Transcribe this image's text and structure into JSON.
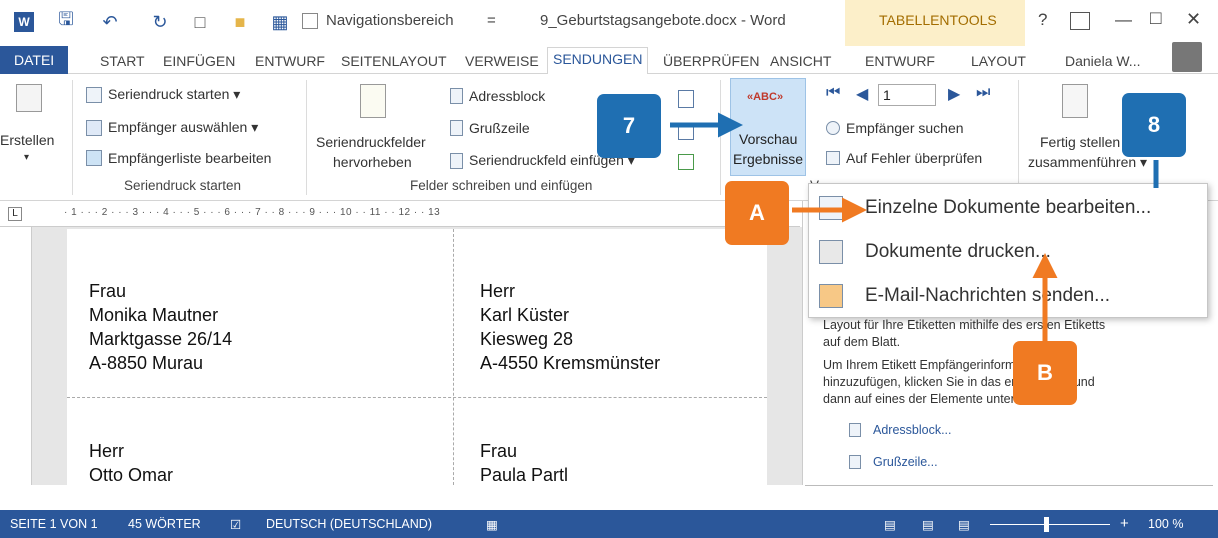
{
  "titlebar": {
    "nav_label": "Navigationsbereich",
    "nav_dropdown": "=",
    "title": "9_Geburtstagsangebote.docx - Word",
    "context_tab": "TABELLENTOOLS",
    "help": "?",
    "min": "—",
    "max": "□",
    "close": "✕"
  },
  "tabs": [
    "DATEI",
    "START",
    "EINFÜGEN",
    "ENTWURF",
    "SEITENLAYOUT",
    "VERWEISE",
    "SENDUNGEN",
    "ÜBERPRÜFEN",
    "ANSICHT",
    "ENTWURF",
    "LAYOUT"
  ],
  "user": "Daniela W...",
  "ribbon": {
    "erstellen": "Erstellen",
    "start_group": {
      "items": [
        "Seriendruck starten ▾",
        "Empfänger auswählen ▾",
        "Empfängerliste bearbeiten"
      ],
      "label": "Seriendruck starten"
    },
    "felder_group": {
      "highlight_1": "Seriendruckfelder",
      "highlight_2": "hervorheben",
      "items": [
        "Adressblock",
        "Grußzeile",
        "Seriendruckfeld einfügen ▾"
      ],
      "label": "Felder schreiben und einfügen"
    },
    "vorschau_1": "Vorschau",
    "vorschau_2": "Ergebnisse",
    "vorschau_icon": "«ABC»",
    "nav_record": "1",
    "find": "Empfänger suchen",
    "check": "Auf Fehler überprüfen",
    "finish_1": "Fertig stellen und",
    "finish_2": "zusammenführen ▾",
    "group_v": "V"
  },
  "ruler": "· 1 · · · 2 · · · 3 · · · 4 · · · 5 · · · 6 · · · 7 · · 8 · · · 9 · · · 10 · · 11 · · 12 · · 13",
  "labels": [
    [
      "Frau",
      "Monika Mautner",
      "Marktgasse 26/14",
      "A-8850 Murau"
    ],
    [
      "Herr",
      "Karl Küster",
      "Kiesweg 28",
      "A-4550 Kremsmünster"
    ],
    [
      "Herr",
      "Otto Omar"
    ],
    [
      "Frau",
      "Paula Partl"
    ]
  ],
  "dropdown": [
    "Einzelne Dokumente bearbeiten...",
    "Dokumente drucken...",
    "E-Mail-Nachrichten senden..."
  ],
  "taskpane": {
    "text1_a": "Layout für Ihre Etiketten mithilfe des ersten Etiketts",
    "text1_b": "auf dem Blatt.",
    "text2_a": "Um Ihrem Etikett Empfängerinformationen",
    "text2_b": "hinzuzufügen, klicken Sie in das erste Etikett und",
    "text2_c": "dann auf eines der Elemente unten.",
    "link1": "Adressblock...",
    "link2": "Grußzeile..."
  },
  "status": {
    "page": "SEITE 1 VON 1",
    "words": "45 WÖRTER",
    "lang": "DEUTSCH (DEUTSCHLAND)",
    "zoom": "100 %"
  },
  "callouts": {
    "c7": "7",
    "c8": "8",
    "cA": "A",
    "cB": "B"
  },
  "colors": {
    "blue": "#1f6fb2",
    "orange": "#f07a22",
    "status": "#2b579a",
    "word": "#2b579a",
    "selected_tab": "#2b579a"
  }
}
